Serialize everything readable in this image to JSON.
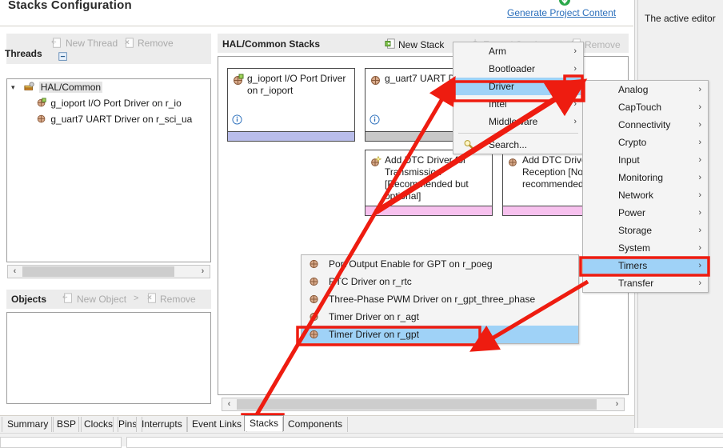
{
  "header": {
    "title": "Stacks Configuration",
    "generate_link": "Generate Project Content",
    "generate_icon": "green-arrow-circle-icon"
  },
  "right_pane": {
    "text": "The active editor"
  },
  "threads_panel": {
    "title": "Threads",
    "new_thread": "New Thread",
    "remove": "Remove",
    "new_thread_icon": "new-thread-icon",
    "remove_icon": "remove-icon",
    "collapse_icon": "collapse-all-icon",
    "tree": [
      {
        "label": "HAL/Common",
        "icon": "hal-common-icon",
        "indent": 0,
        "selected": true,
        "expanded": true
      },
      {
        "label": "g_ioport I/O Port Driver on r_io",
        "icon": "module-icon",
        "indent": 1,
        "selected": false
      },
      {
        "label": "g_uart7 UART Driver on r_sci_ua",
        "icon": "module-icon",
        "indent": 1,
        "selected": false
      }
    ]
  },
  "objects_panel": {
    "title": "Objects",
    "new_object": "New Object",
    "new_object_arrow": ">",
    "remove": "Remove",
    "new_object_icon": "new-object-icon",
    "remove_icon": "remove-icon"
  },
  "stacks_panel": {
    "title": "HAL/Common Stacks",
    "new_stack": "New Stack",
    "new_stack_icon": "new-stack-icon",
    "extend_stack": "Extend Stack",
    "extend_stack_icon": "extend-stack-icon",
    "remove": "Remove",
    "remove_icon": "remove-icon",
    "boxes": [
      {
        "title": "g_ioport I/O Port Driver on r_ioport",
        "icon": "module-icon",
        "info_icon": "info-icon",
        "bar_color": "#b9bdea"
      },
      {
        "title": "g_uart7 UART D",
        "icon": "module-icon",
        "info_icon": "info-icon",
        "bar_color": "#c8c8c8"
      },
      {
        "title": "Add DTC Driver for Transmission [Recommended but optional]",
        "icon": "add-module-icon",
        "bar_color": "#f7c1ee"
      },
      {
        "title": "Add DTC Driver for Reception [Not recommended]",
        "icon": "add-module-icon",
        "bar_color": "#f7c1ee"
      }
    ]
  },
  "menu_level1": {
    "items": [
      {
        "label": "Arm",
        "arrow": "›",
        "selected": false
      },
      {
        "label": "Bootloader",
        "arrow": "›",
        "selected": false
      },
      {
        "label": "Driver",
        "arrow": "›",
        "selected": true
      },
      {
        "label": "Intel",
        "arrow": "›",
        "selected": false
      },
      {
        "label": "Middleware",
        "arrow": "›",
        "selected": false
      }
    ],
    "search": {
      "label": "Search...",
      "icon": "search-icon"
    }
  },
  "menu_level2": {
    "items": [
      {
        "label": "Analog",
        "arrow": "›",
        "selected": false
      },
      {
        "label": "CapTouch",
        "arrow": "›",
        "selected": false
      },
      {
        "label": "Connectivity",
        "arrow": "›",
        "selected": false
      },
      {
        "label": "Crypto",
        "arrow": "›",
        "selected": false
      },
      {
        "label": "Input",
        "arrow": "›",
        "selected": false
      },
      {
        "label": "Monitoring",
        "arrow": "›",
        "selected": false
      },
      {
        "label": "Network",
        "arrow": "›",
        "selected": false
      },
      {
        "label": "Power",
        "arrow": "›",
        "selected": false
      },
      {
        "label": "Storage",
        "arrow": "›",
        "selected": false
      },
      {
        "label": "System",
        "arrow": "›",
        "selected": false
      },
      {
        "label": "Timers",
        "arrow": "›",
        "selected": true
      },
      {
        "label": "Transfer",
        "arrow": "›",
        "selected": false
      }
    ]
  },
  "menu_level3": {
    "items": [
      {
        "label": "Port Output Enable for GPT on r_poeg",
        "icon": "module-icon",
        "selected": false
      },
      {
        "label": "RTC Driver on r_rtc",
        "icon": "module-icon",
        "selected": false
      },
      {
        "label": "Three-Phase PWM Driver on r_gpt_three_phase",
        "icon": "module-icon",
        "selected": false
      },
      {
        "label": "Timer Driver on r_agt",
        "icon": "module-icon",
        "selected": false
      },
      {
        "label": "Timer Driver on r_gpt",
        "icon": "module-icon",
        "selected": true
      }
    ]
  },
  "bottom_tabs": {
    "items": [
      {
        "label": "Summary",
        "active": false
      },
      {
        "label": "BSP",
        "active": false
      },
      {
        "label": "Clocks",
        "active": false
      },
      {
        "label": "Pins",
        "active": false
      },
      {
        "label": "Interrupts",
        "active": false
      },
      {
        "label": "Event Links",
        "active": false
      },
      {
        "label": "Stacks",
        "active": true
      },
      {
        "label": "Components",
        "active": false
      }
    ]
  },
  "annotations": {
    "highlight_color": "#ee1c10",
    "boxes": [
      "driver-menu-item",
      "timers-menu-item",
      "timer-driver-gpt-item",
      "stacks-tab",
      "uart-stack-scroll"
    ],
    "arrows": [
      "stacks-tab-to-driver",
      "timers-to-timer-driver",
      "dtc-to-timer-list"
    ]
  },
  "scrollbars": {
    "left_arrow": "‹",
    "right_arrow": "›"
  }
}
